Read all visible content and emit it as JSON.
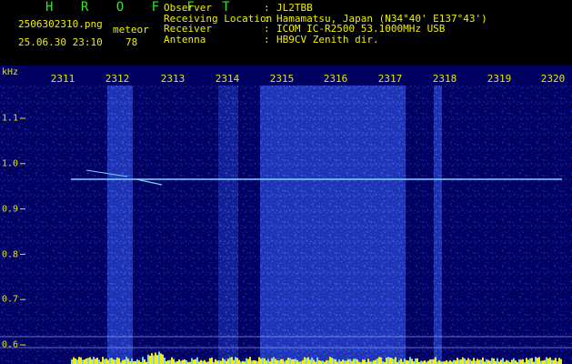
{
  "header": {
    "brand": "H R O F F T",
    "filename": "2506302310.png",
    "datetime": "25.06.30 23:10",
    "meteor_label": "meteor",
    "meteor_count": "78",
    "rows": [
      {
        "key": "Observer",
        "sep": ":",
        "value": "JL2TBB"
      },
      {
        "key": "Receiving Location",
        "sep": ":",
        "value": "Hamamatsu, Japan (N34°40' E137°43')"
      },
      {
        "key": "Receiver",
        "sep": ":",
        "value": "ICOM IC-R2500 53.1000MHz USB"
      },
      {
        "key": "Antenna",
        "sep": ":",
        "value": "HB9CV Zenith dir."
      }
    ]
  },
  "plot": {
    "unit": "kHz",
    "time_labels": [
      "2311",
      "2312",
      "2313",
      "2314",
      "2315",
      "2316",
      "2317",
      "2318",
      "2319",
      "2320"
    ],
    "freq_ticks": [
      "1.1",
      "1.0",
      "0.9",
      "0.8",
      "0.7",
      "0.6"
    ],
    "colors": {
      "background": "#000060",
      "noise": "#3c64ff",
      "carrier": "#7fd0ff",
      "spectrum": "#f0f000",
      "labels": "#e6e600"
    }
  }
}
